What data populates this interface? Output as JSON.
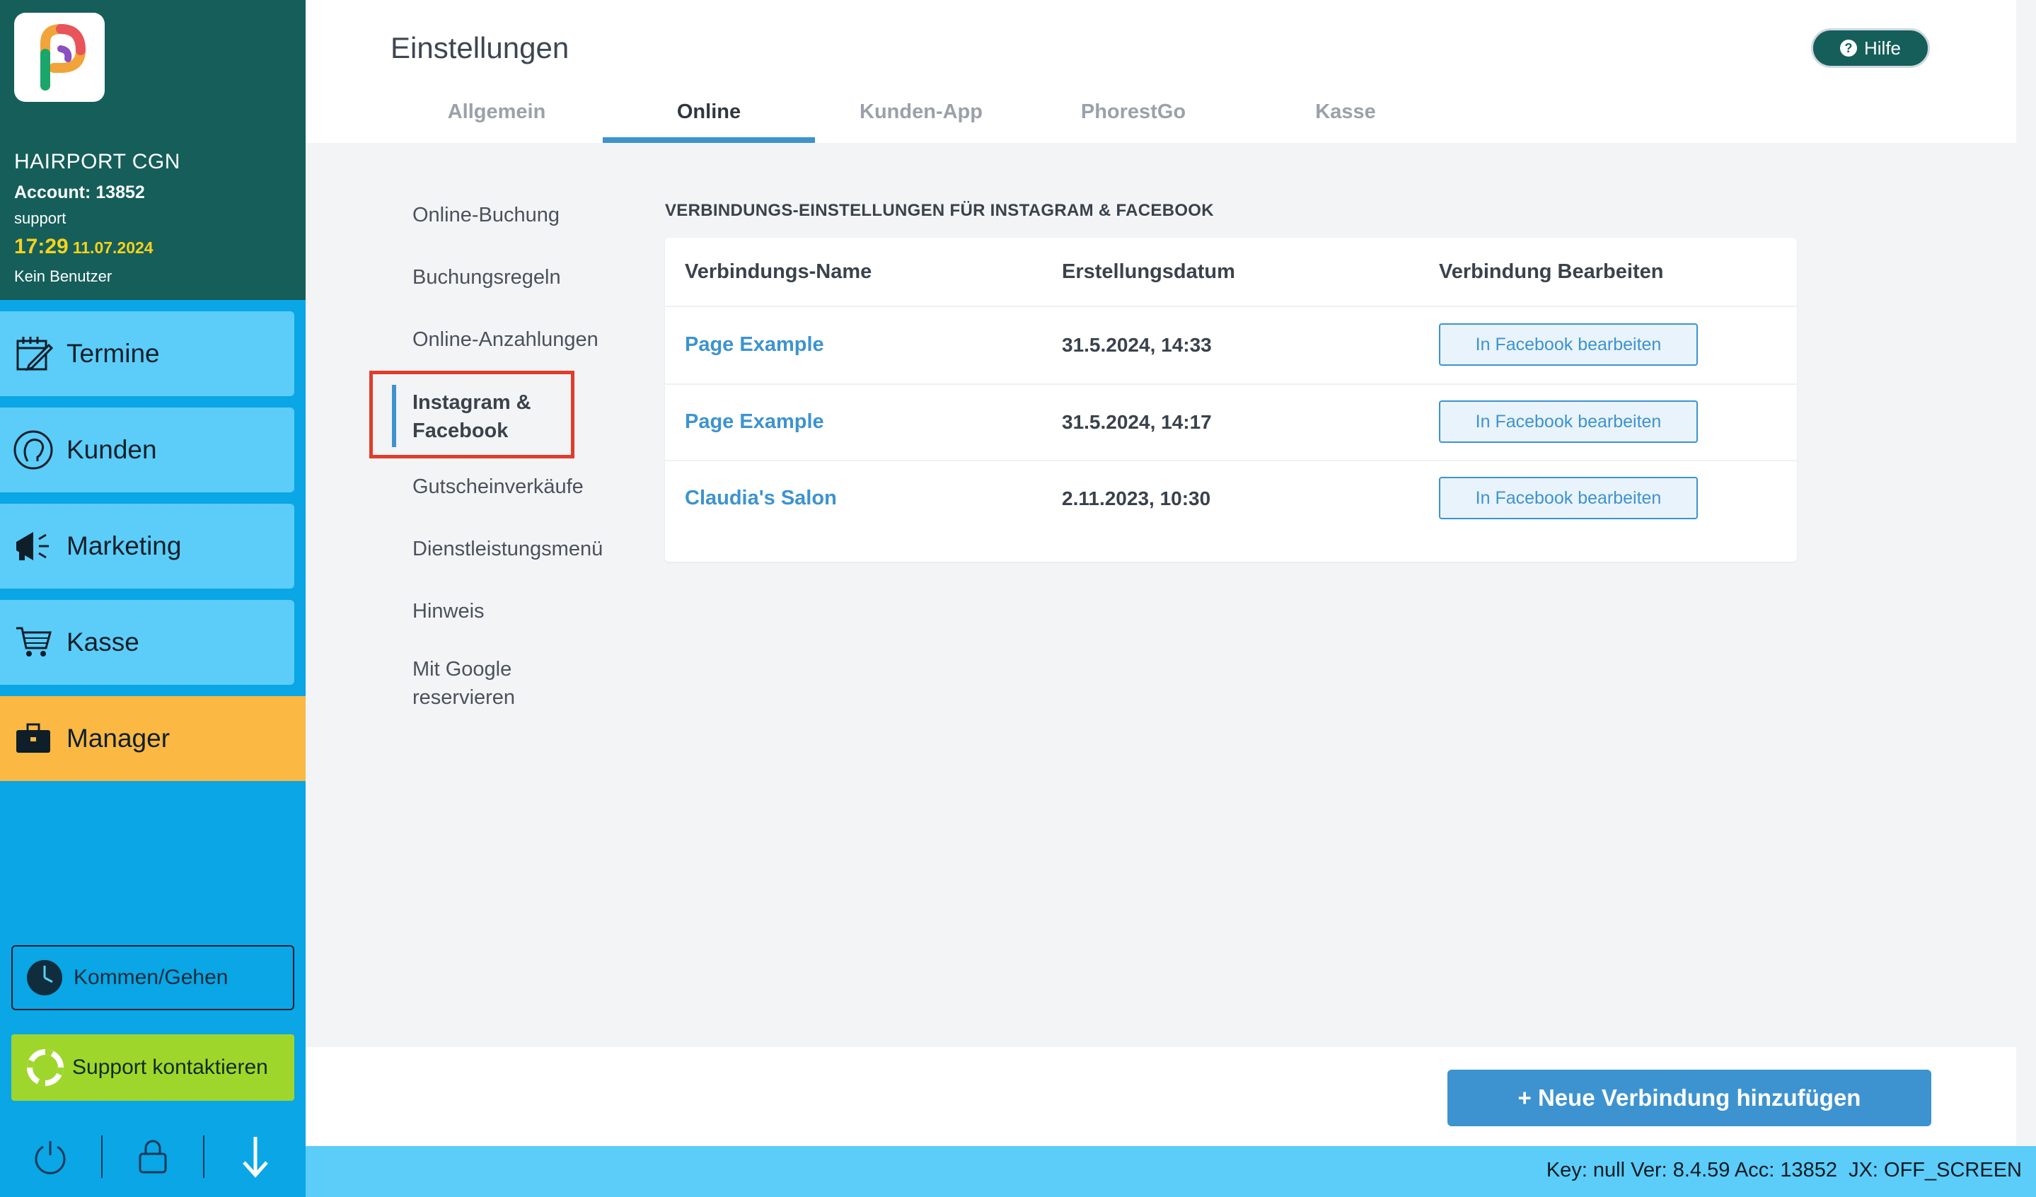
{
  "sidebar": {
    "salon_name": "HAIRPORT CGN",
    "account": "Account: 13852",
    "role": "support",
    "time": "17:29",
    "date": "11.07.2024",
    "user_status": "Kein Benutzer",
    "nav": [
      {
        "label": "Termine",
        "icon": "calendar-edit-icon"
      },
      {
        "label": "Kunden",
        "icon": "customer-head-icon"
      },
      {
        "label": "Marketing",
        "icon": "megaphone-icon"
      },
      {
        "label": "Kasse",
        "icon": "shopping-cart-icon"
      },
      {
        "label": "Manager",
        "icon": "briefcase-icon"
      }
    ],
    "clock_button": "Kommen/Gehen",
    "support_button": "Support kontaktieren",
    "bottom_icons": [
      "power-icon",
      "lock-icon",
      "arrow-down-icon"
    ]
  },
  "header": {
    "title": "Einstellungen",
    "help": "Hilfe",
    "tabs": [
      {
        "label": "Allgemein",
        "active": false
      },
      {
        "label": "Online",
        "active": true
      },
      {
        "label": "Kunden-App",
        "active": false
      },
      {
        "label": "PhorestGo",
        "active": false
      },
      {
        "label": "Kasse",
        "active": false
      }
    ]
  },
  "subnav": {
    "items": [
      "Online-Buchung",
      "Buchungsregeln",
      "Online-Anzahlungen",
      "Gutscheinverkäufe",
      "Dienstleistungsmenü",
      "Hinweis"
    ],
    "active_line1": "Instagram &",
    "active_line2": "Facebook",
    "google_line1": "Mit Google",
    "google_line2": "reservieren"
  },
  "connections": {
    "section_title": "VERBINDUNGS-EINSTELLUNGEN FÜR INSTAGRAM & FACEBOOK",
    "columns": [
      "Verbindungs-Name",
      "Erstellungsdatum",
      "Verbindung Bearbeiten"
    ],
    "rows": [
      {
        "name": "Page Example",
        "date": "31.5.2024, 14:33",
        "action": "In Facebook bearbeiten"
      },
      {
        "name": "Page Example",
        "date": "31.5.2024, 14:17",
        "action": "In Facebook bearbeiten"
      },
      {
        "name": "Claudia's Salon",
        "date": "2.11.2023, 10:30",
        "action": "In Facebook bearbeiten"
      }
    ],
    "add_button": "+ Neue Verbindung hinzufügen"
  },
  "status_bar": {
    "text": "Key: null Ver: 8.4.59 Acc: 13852  JX: OFF_SCREEN"
  },
  "colors": {
    "sidebar_header": "#155e5a",
    "sidebar": "#0aa6e6",
    "nav_item": "#5bcdf8",
    "nav_active": "#fbb843",
    "accent": "#3d93cf",
    "support": "#9fd62c",
    "highlight_box": "#e23c2b"
  }
}
